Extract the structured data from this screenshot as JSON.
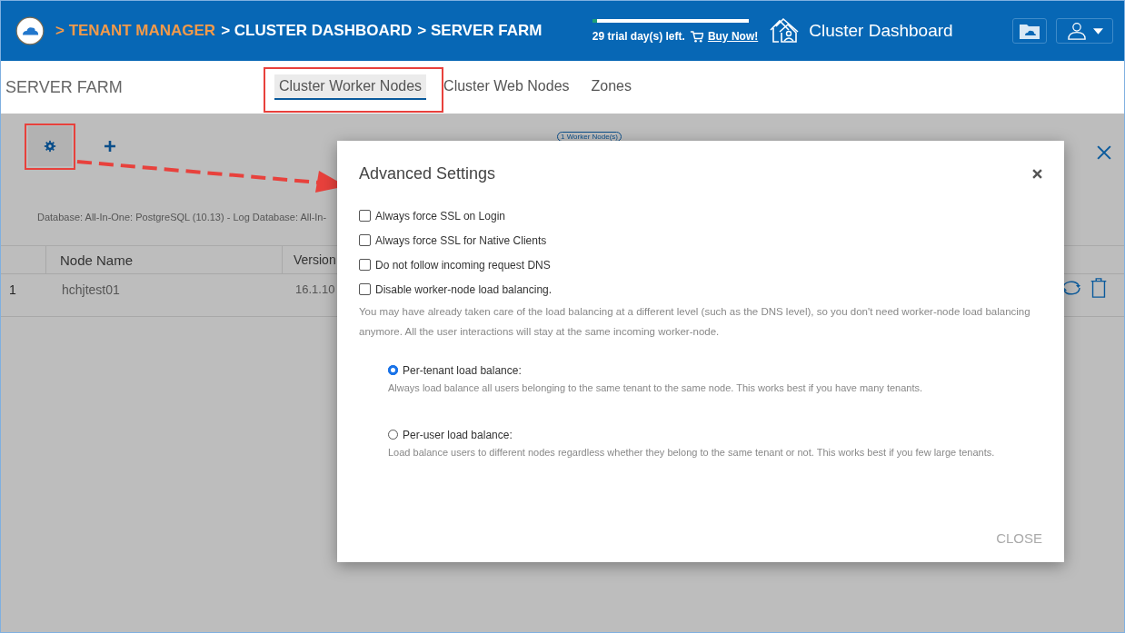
{
  "header": {
    "breadcrumbs": [
      {
        "label": "> TENANT MANAGER",
        "kind": "link"
      },
      {
        "label": "> CLUSTER DASHBOARD",
        "kind": "current"
      },
      {
        "label": "> SERVER FARM",
        "kind": "current"
      }
    ],
    "trial": {
      "level": 0.03,
      "text": "29 trial day(s) left.",
      "buy": "Buy Now!"
    },
    "app_title": "Cluster Dashboard"
  },
  "page_title": "SERVER FARM",
  "tabs": [
    {
      "label": "Cluster Worker Nodes",
      "selected": true
    },
    {
      "label": "Cluster Web Nodes",
      "selected": false
    },
    {
      "label": "Zones",
      "selected": false
    }
  ],
  "node_count": "1 Worker Node(s)",
  "database_info": "Database: All-In-One: PostgreSQL (10.13) - Log Database: All-In-",
  "table": {
    "columns": [
      "Node Name",
      "Version"
    ],
    "rows": [
      {
        "index": "1",
        "name": "hchjtest01",
        "version": "16.1.10"
      }
    ]
  },
  "dialog": {
    "title": "Advanced Settings",
    "options": [
      {
        "label": "Always force SSL on Login",
        "checked": false
      },
      {
        "label": "Always force SSL for Native Clients",
        "checked": false
      },
      {
        "label": "Do not follow incoming request DNS",
        "checked": false
      },
      {
        "label": "Disable worker-node load balancing.",
        "checked": false
      }
    ],
    "note": "You may have already taken care of the load balancing at a different level (such as the DNS level), so you don't need worker-node load balancing anymore. All the user interactions will stay at the same incoming worker-node.",
    "modes": [
      {
        "label": "Per-tenant load balance:",
        "selected": true,
        "description": "Always load balance all users belonging to the same tenant to the same node. This works best if you have many tenants."
      },
      {
        "label": "Per-user load balance:",
        "selected": false,
        "description": "Load balance users to different nodes regardless whether they belong to the same tenant or not. This works best if you few large tenants."
      }
    ],
    "close": "CLOSE"
  }
}
